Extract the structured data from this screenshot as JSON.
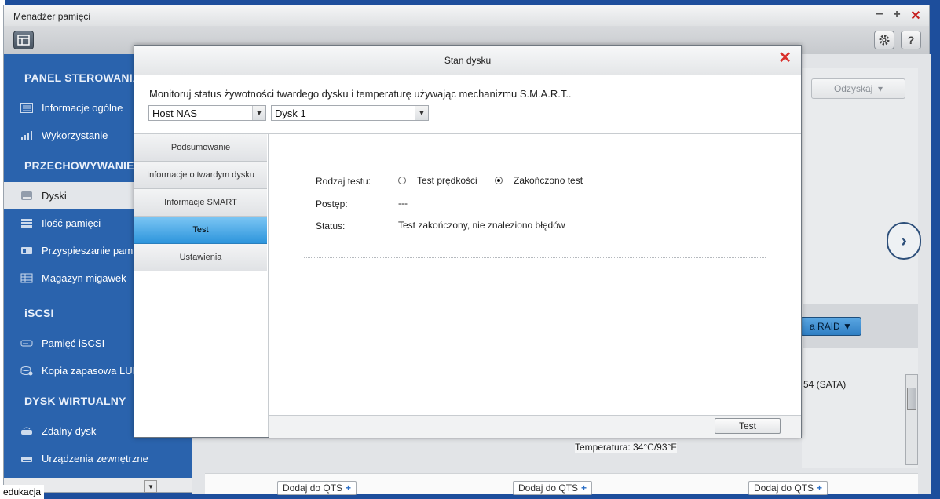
{
  "app": {
    "title": "Menadżer pamięci",
    "controls": {
      "minimize": "−",
      "maximize": "+",
      "close": "✕"
    },
    "help_label": "?"
  },
  "sidebar": {
    "sections": [
      {
        "title": "PANEL STEROWANIA",
        "items": [
          {
            "label": "Informacje ogólne",
            "icon": "info-list-icon"
          },
          {
            "label": "Wykorzystanie",
            "icon": "bar-chart-icon"
          }
        ]
      },
      {
        "title": "PRZECHOWYWANIE",
        "items": [
          {
            "label": "Dyski",
            "icon": "disk-icon",
            "active": true
          },
          {
            "label": "Ilość pamięci",
            "icon": "storage-icon"
          },
          {
            "label": "Przyspieszanie pamięci",
            "icon": "cache-icon"
          },
          {
            "label": "Magazyn migawek",
            "icon": "snapshot-icon"
          }
        ]
      },
      {
        "title": "iSCSI",
        "items": [
          {
            "label": "Pamięć iSCSI",
            "icon": "iscsi-disk-icon"
          },
          {
            "label": "Kopia zapasowa LUN",
            "icon": "backup-icon"
          }
        ]
      },
      {
        "title": "DYSK WIRTUALNY",
        "items": [
          {
            "label": "Zdalny dysk",
            "icon": "remote-disk-icon"
          },
          {
            "label": "Urządzenia zewnętrzne",
            "icon": "external-device-icon"
          }
        ]
      }
    ]
  },
  "background": {
    "recover_button": "Odzyskaj",
    "raid_button": "a RAID ▼",
    "sata_text": "54 (SATA)",
    "temperature": "Temperatura: 34°C/93°F",
    "add_qts_label": "Dodaj do QTS",
    "taskbar_text": "edukacja"
  },
  "dialog": {
    "title": "Stan dysku",
    "description": "Monitoruj status żywotności twardego dysku i temperaturę używając mechanizmu S.M.A.R.T..",
    "host_select": "Host NAS",
    "disk_select": "Dysk 1",
    "tabs": [
      {
        "label": "Podsumowanie"
      },
      {
        "label": "Informacje o twardym dysku"
      },
      {
        "label": "Informacje SMART"
      },
      {
        "label": "Test",
        "active": true
      },
      {
        "label": "Ustawienia"
      }
    ],
    "test": {
      "type_label": "Rodzaj testu:",
      "option_speed": "Test prędkości",
      "option_done": "Zakończono test",
      "selected": "Zakończono test",
      "progress_label": "Postęp:",
      "progress_value": "---",
      "status_label": "Status:",
      "status_value": "Test zakończony, nie znaleziono błędów"
    },
    "footer_button": "Test"
  }
}
